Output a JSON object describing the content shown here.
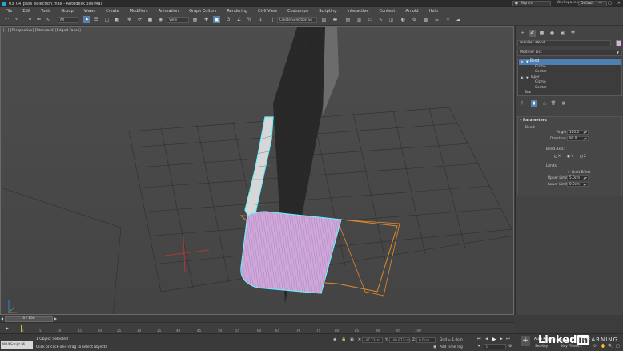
{
  "window": {
    "title": "03_04_pass_selection.max - Autodesk 3ds Max",
    "sign_in": "Sign In",
    "workspaces_label": "Workspaces:",
    "workspaces_value": "Default"
  },
  "menu": [
    "File",
    "Edit",
    "Tools",
    "Group",
    "Views",
    "Create",
    "Modifiers",
    "Animation",
    "Graph Editors",
    "Rendering",
    "Civil View",
    "Customize",
    "Scripting",
    "Interactive",
    "Content",
    "Arnold",
    "Help"
  ],
  "toolbar": {
    "filter_value": "All",
    "ref_coord": "View",
    "selection_set": "Create Selection Se"
  },
  "viewport": {
    "label": "[+] [Perspective] [Standard] [Edged Faces]"
  },
  "panel": {
    "object_name": "monitor stand",
    "modifier_list": "Modifier List",
    "stack": [
      {
        "label": "Bend",
        "indent": false,
        "selected": true,
        "eye": true,
        "expand": true
      },
      {
        "label": "Gizmo",
        "indent": true,
        "selected": false,
        "eye": false,
        "expand": false
      },
      {
        "label": "Center",
        "indent": true,
        "selected": false,
        "eye": false,
        "expand": false
      },
      {
        "label": "Taper",
        "indent": false,
        "selected": false,
        "eye": true,
        "expand": true
      },
      {
        "label": "Gizmo",
        "indent": true,
        "selected": false,
        "eye": false,
        "expand": false
      },
      {
        "label": "Center",
        "indent": true,
        "selected": false,
        "eye": false,
        "expand": false
      },
      {
        "label": "Box",
        "indent": false,
        "selected": false,
        "eye": false,
        "expand": false
      }
    ],
    "rollout": {
      "title": "Parameters",
      "bend_label": "Bend:",
      "angle_label": "Angle:",
      "angle_value": "100.0",
      "direction_label": "Direction:",
      "direction_value": "90.0",
      "axis_label": "Bend Axis:",
      "axis_x": "X",
      "axis_y": "Y",
      "axis_z": "Z",
      "axis_selected": "Y",
      "limits_label": "Limits",
      "limit_effect": "Limit Effect",
      "upper_label": "Upper Limit:",
      "upper_value": "5.0cm",
      "lower_label": "Lower Limit:",
      "lower_value": "0.0cm"
    }
  },
  "timeline": {
    "frame_display": "0 / 100",
    "ticks": [
      "0",
      "5",
      "10",
      "15",
      "20",
      "25",
      "30",
      "35",
      "40",
      "45",
      "50",
      "55",
      "60",
      "65",
      "70",
      "75",
      "80",
      "85",
      "90",
      "95",
      "100"
    ]
  },
  "status": {
    "maxscript": "MAXScript Mi",
    "selected": "1 Object Selected",
    "prompt": "Click or click-and-drag to select objects",
    "x_label": "X:",
    "x_value": "-47.22cm",
    "y_label": "Y:",
    "y_value": "-49.872cm",
    "z_label": "Z:",
    "z_value": "0.0cm",
    "grid": "Grid = 1.0cm",
    "add_time_tag": "Add Time Tag",
    "frame": "0",
    "auto_key": "Auto Key",
    "selected_dd": "Selected",
    "set_key": "Set Key",
    "key_filters": "Key Filters..."
  },
  "watermark": {
    "brand": "Linked",
    "brand_in": "in",
    "learning": "LEARNING"
  },
  "colors": {
    "selection": "#4e7fb4",
    "object": "#d9b0e8",
    "highlight": "#6ff0ff",
    "gizmo": "#e08a2a"
  }
}
